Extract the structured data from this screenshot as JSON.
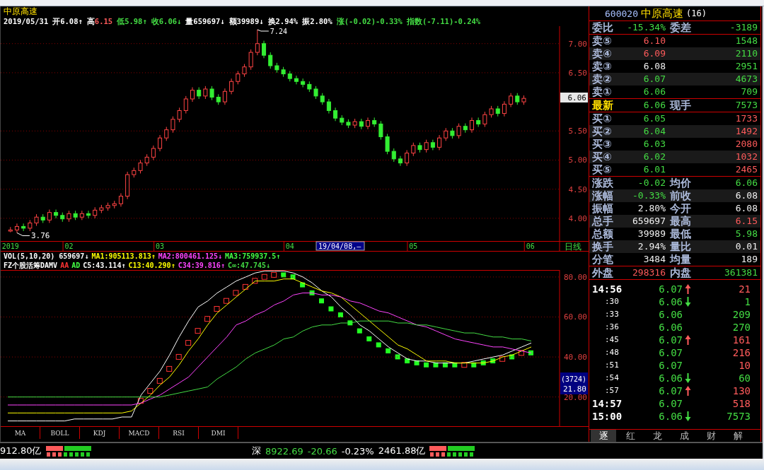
{
  "stock_title": "中原高速",
  "info_line": [
    {
      "text": "2019/05/31",
      "color": "#ffffff"
    },
    {
      "text": "开6.08↑",
      "color": "#ffffff"
    },
    {
      "text": "高",
      "color": "#ffffff"
    },
    {
      "text": "6.15",
      "color": "#ff5b5b"
    },
    {
      "text": "低5.98↑",
      "color": "#44dd44"
    },
    {
      "text": "收6.06↓",
      "color": "#44dd44"
    },
    {
      "text": "量659697↓",
      "color": "#ffffff"
    },
    {
      "text": "额39989↓",
      "color": "#ffffff"
    },
    {
      "text": "换2.94%",
      "color": "#ffffff"
    },
    {
      "text": "振2.80%",
      "color": "#ffffff"
    },
    {
      "text": "涨(-0.02)-0.33%",
      "color": "#44dd44"
    },
    {
      "text": "指数(-7.11)-0.24%",
      "color": "#44dd44"
    }
  ],
  "price_chart": {
    "chart_data": {
      "type": "candlestick",
      "grid": true,
      "categories": [
        null,
        "2019",
        null,
        null,
        null,
        null,
        null,
        null,
        null,
        null,
        "02",
        null,
        null,
        null,
        null,
        null,
        null,
        null,
        null,
        null,
        null,
        null,
        null,
        null,
        "03",
        null,
        null,
        null,
        null,
        null,
        null,
        null,
        null,
        null,
        null,
        null,
        null,
        null,
        null,
        null,
        null,
        null,
        null,
        null,
        "04",
        null,
        null,
        null,
        null,
        null,
        null,
        null,
        null,
        null,
        null,
        null,
        null,
        null,
        null,
        null,
        null,
        null,
        null,
        "05",
        null,
        null,
        null,
        null,
        null,
        null,
        null,
        null,
        null,
        null,
        null,
        null,
        null,
        null,
        null,
        null,
        null,
        "06",
        null,
        null,
        null,
        null
      ],
      "ohlc": [
        null,
        [
          3.78,
          3.85,
          3.76,
          3.8
        ],
        [
          3.8,
          3.91,
          3.75,
          3.86
        ],
        [
          3.86,
          3.91,
          3.78,
          3.83
        ],
        [
          3.83,
          3.97,
          3.78,
          3.92
        ],
        [
          3.92,
          4.07,
          3.87,
          4.02
        ],
        [
          4.02,
          4.07,
          3.92,
          3.97
        ],
        [
          3.97,
          4.15,
          3.92,
          4.1
        ],
        [
          4.1,
          4.15,
          4.0,
          4.05
        ],
        [
          4.05,
          4.1,
          3.94,
          3.99
        ],
        [
          3.99,
          4.13,
          3.94,
          4.08
        ],
        [
          4.08,
          4.13,
          3.97,
          4.02
        ],
        [
          4.02,
          4.13,
          3.97,
          4.08
        ],
        [
          4.08,
          4.13,
          4.0,
          4.05
        ],
        [
          4.05,
          4.19,
          4.0,
          4.14
        ],
        [
          4.14,
          4.23,
          4.09,
          4.18
        ],
        [
          4.18,
          4.27,
          4.13,
          4.22
        ],
        [
          4.22,
          4.3,
          4.17,
          4.25
        ],
        [
          4.25,
          4.43,
          4.2,
          4.38
        ],
        [
          4.38,
          4.8,
          4.33,
          4.75
        ],
        [
          4.75,
          4.87,
          4.7,
          4.82
        ],
        [
          4.82,
          5.0,
          4.77,
          4.95
        ],
        [
          4.95,
          5.1,
          4.9,
          5.05
        ],
        [
          5.05,
          5.25,
          5.0,
          5.2
        ],
        [
          5.2,
          5.43,
          5.15,
          5.38
        ],
        [
          5.38,
          5.57,
          5.33,
          5.52
        ],
        [
          5.52,
          5.75,
          5.47,
          5.7
        ],
        [
          5.7,
          5.9,
          5.65,
          5.85
        ],
        [
          5.85,
          6.1,
          5.8,
          6.05
        ],
        [
          6.05,
          6.25,
          6.0,
          6.2
        ],
        [
          6.2,
          6.25,
          6.05,
          6.1
        ],
        [
          6.1,
          6.27,
          6.05,
          6.22
        ],
        [
          6.22,
          6.27,
          6.03,
          6.08
        ],
        [
          6.08,
          6.13,
          5.95,
          6.0
        ],
        [
          6.0,
          6.23,
          5.95,
          6.18
        ],
        [
          6.18,
          6.4,
          6.13,
          6.35
        ],
        [
          6.35,
          6.53,
          6.3,
          6.48
        ],
        [
          6.48,
          6.65,
          6.43,
          6.6
        ],
        [
          6.6,
          6.9,
          6.55,
          6.85
        ],
        [
          6.85,
          7.24,
          6.8,
          7.0
        ],
        [
          7.0,
          7.05,
          6.75,
          6.8
        ],
        [
          6.8,
          6.85,
          6.57,
          6.62
        ],
        [
          6.62,
          6.67,
          6.5,
          6.55
        ],
        [
          6.55,
          6.6,
          6.43,
          6.48
        ],
        [
          6.48,
          6.53,
          6.35,
          6.4
        ],
        [
          6.4,
          6.45,
          6.3,
          6.35
        ],
        [
          6.35,
          6.4,
          6.25,
          6.3
        ],
        [
          6.3,
          6.35,
          6.17,
          6.22
        ],
        [
          6.22,
          6.27,
          6.05,
          6.1
        ],
        [
          6.1,
          6.15,
          5.95,
          6.0
        ],
        [
          6.0,
          6.05,
          5.8,
          5.85
        ],
        [
          5.85,
          5.9,
          5.67,
          5.72
        ],
        [
          5.72,
          5.77,
          5.6,
          5.65
        ],
        [
          5.65,
          5.7,
          5.55,
          5.6
        ],
        [
          5.6,
          5.71,
          5.55,
          5.66
        ],
        [
          5.66,
          5.71,
          5.53,
          5.58
        ],
        [
          5.58,
          5.73,
          5.53,
          5.68
        ],
        [
          5.68,
          5.73,
          5.57,
          5.62
        ],
        [
          5.62,
          5.67,
          5.35,
          5.4
        ],
        [
          5.4,
          5.45,
          5.1,
          5.15
        ],
        [
          5.15,
          5.2,
          4.97,
          5.02
        ],
        [
          5.02,
          5.07,
          4.9,
          4.95
        ],
        [
          4.95,
          5.17,
          4.9,
          5.12
        ],
        [
          5.12,
          5.3,
          5.07,
          5.25
        ],
        [
          5.25,
          5.3,
          5.13,
          5.18
        ],
        [
          5.18,
          5.35,
          5.13,
          5.3
        ],
        [
          5.3,
          5.35,
          5.17,
          5.22
        ],
        [
          5.22,
          5.43,
          5.17,
          5.38
        ],
        [
          5.38,
          5.55,
          5.33,
          5.5
        ],
        [
          5.5,
          5.55,
          5.37,
          5.42
        ],
        [
          5.42,
          5.63,
          5.37,
          5.58
        ],
        [
          5.58,
          5.63,
          5.47,
          5.52
        ],
        [
          5.52,
          5.73,
          5.47,
          5.68
        ],
        [
          5.68,
          5.73,
          5.57,
          5.62
        ],
        [
          5.62,
          5.83,
          5.57,
          5.78
        ],
        [
          5.78,
          5.93,
          5.73,
          5.88
        ],
        [
          5.88,
          5.93,
          5.75,
          5.8
        ],
        [
          5.8,
          6.01,
          5.75,
          5.96
        ],
        [
          5.96,
          6.15,
          5.91,
          6.1
        ],
        [
          6.1,
          6.15,
          5.95,
          6.0
        ],
        [
          6.0,
          6.11,
          5.95,
          6.06
        ],
        null,
        null,
        null,
        null,
        null
      ],
      "ylim": [
        3.61,
        7.3
      ],
      "yticks": [
        {
          "value": 7,
          "label": "7.00"
        },
        {
          "value": 6.5,
          "label": "6.50"
        },
        {
          "value": 5.5,
          "label": "5.50"
        },
        {
          "value": 5,
          "label": "5.00"
        },
        {
          "value": 4.5,
          "label": "4.50"
        },
        {
          "value": 4,
          "label": "4.00"
        }
      ],
      "annotations": [
        {
          "text": "7.24"
        },
        {
          "text": "3.76"
        }
      ]
    }
  },
  "last_price_marker": "6.06",
  "cursor_date": "19/04/08,—",
  "period": "日线",
  "volume_header": [
    {
      "text": "VOL(5,10,20) 659697↓",
      "color": "#ffffff"
    },
    {
      "text": "MA1:905113.813↑",
      "color": "#ffff00"
    },
    {
      "text": "MA2:800461.125↓",
      "color": "#ff44ff"
    },
    {
      "text": "MA3:759937.5↑",
      "color": "#44ff44"
    }
  ],
  "indicator_header": [
    {
      "text": "FZ个股活筹DAMV",
      "color": "#ffffff"
    },
    {
      "text": "AA",
      "color": "#ff3333"
    },
    {
      "text": "AD",
      "color": "#44ff44"
    }
  ],
  "indicator_chart": {
    "chart_data": {
      "type": "line",
      "grid": true,
      "ylim": [
        5.4,
        83.5
      ],
      "yticks": [
        {
          "value": 80,
          "label": "80.00"
        },
        {
          "value": 60,
          "label": "60.00"
        },
        {
          "value": 40,
          "label": "40.00"
        },
        {
          "value": 20,
          "label": "20.00"
        }
      ],
      "series": [
        {
          "name": "C5",
          "color": "#ffffff",
          "values": [
            8,
            8,
            8,
            8,
            8,
            8,
            8,
            9,
            9,
            9,
            9,
            9,
            10,
            10,
            21,
            27,
            33,
            41,
            50,
            58,
            65,
            68,
            72,
            75,
            78,
            80,
            82,
            83,
            83,
            83,
            82,
            80,
            77,
            73,
            70,
            65,
            61,
            56,
            53,
            49,
            45,
            42,
            39,
            38,
            38,
            37,
            37,
            37,
            37,
            38,
            39,
            40,
            41,
            43,
            45,
            47
          ]
        },
        {
          "name": "C13",
          "color": "#ffff00",
          "values": [
            12,
            12,
            12,
            12,
            12,
            12,
            12,
            12,
            12,
            12,
            12,
            12,
            12,
            13,
            17,
            21,
            26,
            30,
            36,
            43,
            49,
            56,
            62,
            66,
            70,
            74,
            78,
            78,
            78,
            79,
            79,
            77,
            75,
            73,
            72,
            70,
            66,
            62,
            58,
            54,
            50,
            46,
            44,
            41,
            38,
            38,
            38,
            37,
            37,
            37,
            37,
            38,
            40,
            41,
            43,
            45
          ]
        },
        {
          "name": "C34",
          "color": "#ff44ff",
          "values": [
            16,
            16,
            16,
            16,
            16,
            16,
            16,
            16,
            16,
            16,
            16,
            16,
            16,
            16,
            17,
            19,
            21,
            24,
            27,
            30,
            35,
            40,
            45,
            50,
            56,
            58,
            61,
            63,
            66,
            68,
            71,
            72,
            72,
            71,
            71,
            70,
            68,
            67,
            65,
            63,
            62,
            60,
            58,
            56,
            55,
            53,
            51,
            49,
            48,
            47,
            46,
            45,
            45,
            44,
            43,
            42
          ]
        },
        {
          "name": "C∞",
          "color": "#44dd44",
          "values": [
            20,
            20,
            20,
            20,
            20,
            20,
            20,
            20,
            20,
            20,
            20,
            20,
            20,
            20,
            20,
            20,
            20,
            21,
            22,
            23,
            24,
            25,
            29,
            32,
            35,
            39,
            42,
            44,
            46,
            49,
            50,
            53,
            55,
            56,
            56,
            57,
            57,
            58,
            58,
            58,
            58,
            57,
            57,
            56,
            56,
            55,
            54,
            53,
            52,
            52,
            51,
            50,
            50,
            49,
            49,
            48
          ]
        }
      ]
    }
  },
  "indicator_readings": [
    ":43.114↑",
    ":40.290↑",
    ":39.816↑",
    ":47.745↓"
  ],
  "indicator_marker_top": "(3724)",
  "indicator_marker_value": "21.80",
  "indicator_tabs": [
    {
      "label": "MA",
      "selected": false
    },
    {
      "label": "BOLL",
      "selected": false
    },
    {
      "label": "KDJ",
      "selected": false
    },
    {
      "label": "MACD",
      "selected": false
    },
    {
      "label": "RSI",
      "selected": false
    },
    {
      "label": "DMI",
      "selected": false
    }
  ],
  "quote": {
    "code": "600020",
    "name": "中原高速",
    "count": "(16)",
    "groups": [
      {
        "rows": [
          {
            "kind": "pair",
            "cells": [
              {
                "text": "委比",
                "color": "#aab8d8"
              },
              {
                "text": "-15.34%",
                "color": "#44dd44"
              },
              {
                "text": "委差",
                "color": "#aab8d8"
              },
              {
                "text": "-3189",
                "color": "#44dd44"
              }
            ]
          }
        ]
      },
      {
        "rows": [
          {
            "kind": "book",
            "cells": [
              {
                "text": "卖⑤",
                "color": "#aab8d8"
              },
              {
                "text": "6.10",
                "color": "#ff5b5b"
              },
              {
                "text": "1548",
                "color": "#44dd44"
              }
            ]
          },
          {
            "kind": "book",
            "cells": [
              {
                "text": "卖④",
                "color": "#aab8d8"
              },
              {
                "text": "6.09",
                "color": "#ff5b5b"
              },
              {
                "text": "2110",
                "color": "#44dd44"
              }
            ]
          },
          {
            "kind": "book",
            "cells": [
              {
                "text": "卖③",
                "color": "#aab8d8"
              },
              {
                "text": "6.08",
                "color": "#f0f0f0"
              },
              {
                "text": "2951",
                "color": "#44dd44"
              }
            ]
          },
          {
            "kind": "book",
            "cells": [
              {
                "text": "卖②",
                "color": "#aab8d8"
              },
              {
                "text": "6.07",
                "color": "#44dd44"
              },
              {
                "text": "4673",
                "color": "#44dd44"
              }
            ]
          },
          {
            "kind": "book",
            "cells": [
              {
                "text": "卖①",
                "color": "#aab8d8"
              },
              {
                "text": "6.06",
                "color": "#44dd44"
              },
              {
                "text": "709",
                "color": "#44dd44"
              }
            ]
          }
        ]
      },
      {
        "rows": [
          {
            "kind": "pair",
            "cells": [
              {
                "text": "最新",
                "color": "#ffe000"
              },
              {
                "text": "6.06",
                "color": "#44dd44"
              },
              {
                "text": "现手",
                "color": "#aab8d8"
              },
              {
                "text": "7573",
                "color": "#44dd44"
              }
            ]
          }
        ]
      },
      {
        "rows": [
          {
            "kind": "book",
            "cells": [
              {
                "text": "买①",
                "color": "#aab8d8"
              },
              {
                "text": "6.05",
                "color": "#44dd44"
              },
              {
                "text": "1733",
                "color": "#ff5b5b"
              }
            ]
          },
          {
            "kind": "book",
            "cells": [
              {
                "text": "买②",
                "color": "#aab8d8"
              },
              {
                "text": "6.04",
                "color": "#44dd44"
              },
              {
                "text": "1492",
                "color": "#ff5b5b"
              }
            ]
          },
          {
            "kind": "book",
            "cells": [
              {
                "text": "买③",
                "color": "#aab8d8"
              },
              {
                "text": "6.03",
                "color": "#44dd44"
              },
              {
                "text": "2080",
                "color": "#ff5b5b"
              }
            ]
          },
          {
            "kind": "book",
            "cells": [
              {
                "text": "买④",
                "color": "#aab8d8"
              },
              {
                "text": "6.02",
                "color": "#44dd44"
              },
              {
                "text": "1032",
                "color": "#ff5b5b"
              }
            ]
          },
          {
            "kind": "book",
            "cells": [
              {
                "text": "买⑤",
                "color": "#aab8d8"
              },
              {
                "text": "6.01",
                "color": "#44dd44"
              },
              {
                "text": "2465",
                "color": "#ff5b5b"
              }
            ]
          }
        ]
      },
      {
        "rows": [
          {
            "kind": "pair",
            "cells": [
              {
                "text": "涨跌",
                "color": "#aab8d8"
              },
              {
                "text": "-0.02",
                "color": "#44dd44"
              },
              {
                "text": "均价",
                "color": "#aab8d8"
              },
              {
                "text": "6.06",
                "color": "#44dd44"
              }
            ]
          },
          {
            "kind": "pair",
            "cells": [
              {
                "text": "涨幅",
                "color": "#aab8d8"
              },
              {
                "text": "-0.33%",
                "color": "#44dd44"
              },
              {
                "text": "前收",
                "color": "#aab8d8"
              },
              {
                "text": "6.08",
                "color": "#f0f0f0"
              }
            ]
          },
          {
            "kind": "pair",
            "cells": [
              {
                "text": "振幅",
                "color": "#aab8d8"
              },
              {
                "text": "2.80%",
                "color": "#f0f0f0"
              },
              {
                "text": "今开",
                "color": "#aab8d8"
              },
              {
                "text": "6.08",
                "color": "#f0f0f0"
              }
            ]
          },
          {
            "kind": "pair",
            "cells": [
              {
                "text": "总手",
                "color": "#aab8d8"
              },
              {
                "text": "659697",
                "color": "#f0f0f0"
              },
              {
                "text": "最高",
                "color": "#aab8d8"
              },
              {
                "text": "6.15",
                "color": "#ff5b5b"
              }
            ]
          },
          {
            "kind": "pair",
            "cells": [
              {
                "text": "总额",
                "color": "#aab8d8"
              },
              {
                "text": "39989",
                "color": "#f0f0f0"
              },
              {
                "text": "最低",
                "color": "#aab8d8"
              },
              {
                "text": "5.98",
                "color": "#44dd44"
              }
            ]
          },
          {
            "kind": "pair",
            "cells": [
              {
                "text": "换手",
                "color": "#aab8d8"
              },
              {
                "text": "2.94%",
                "color": "#f0f0f0"
              },
              {
                "text": "量比",
                "color": "#aab8d8"
              },
              {
                "text": "0.01",
                "color": "#f0f0f0"
              }
            ]
          },
          {
            "kind": "pair",
            "cells": [
              {
                "text": "分笔",
                "color": "#aab8d8"
              },
              {
                "text": "3484",
                "color": "#f0f0f0"
              },
              {
                "text": "均量",
                "color": "#aab8d8"
              },
              {
                "text": "189",
                "color": "#f0f0f0"
              }
            ]
          }
        ]
      },
      {
        "rows": [
          {
            "kind": "pair",
            "cells": [
              {
                "text": "外盘",
                "color": "#aab8d8"
              },
              {
                "text": "298316",
                "color": "#ff5b5b"
              },
              {
                "text": "内盘",
                "color": "#aab8d8"
              },
              {
                "text": "361381",
                "color": "#44dd44"
              }
            ]
          }
        ]
      }
    ],
    "trades": [
      {
        "time": "14:56",
        "kind": "full",
        "price": "6.07",
        "arrow_up": true,
        "arrow_down": false,
        "volume": "21",
        "color": "#ff5b5b"
      },
      {
        "time": ":30",
        "kind": "tick",
        "price": "6.06",
        "arrow_up": false,
        "arrow_down": true,
        "volume": "1",
        "color": "#44dd44"
      },
      {
        "time": ":33",
        "kind": "tick",
        "price": "6.06",
        "arrow_up": false,
        "arrow_down": false,
        "volume": "209",
        "color": "#44dd44"
      },
      {
        "time": ":36",
        "kind": "tick",
        "price": "6.06",
        "arrow_up": false,
        "arrow_down": false,
        "volume": "270",
        "color": "#44dd44"
      },
      {
        "time": ":45",
        "kind": "tick",
        "price": "6.07",
        "arrow_up": true,
        "arrow_down": false,
        "volume": "161",
        "color": "#ff5b5b"
      },
      {
        "time": ":48",
        "kind": "tick",
        "price": "6.07",
        "arrow_up": false,
        "arrow_down": false,
        "volume": "216",
        "color": "#ff5b5b"
      },
      {
        "time": ":51",
        "kind": "tick",
        "price": "6.07",
        "arrow_up": false,
        "arrow_down": false,
        "volume": "10",
        "color": "#ff5b5b"
      },
      {
        "time": ":54",
        "kind": "tick",
        "price": "6.06",
        "arrow_up": false,
        "arrow_down": true,
        "volume": "60",
        "color": "#44dd44"
      },
      {
        "time": ":57",
        "kind": "tick",
        "price": "6.07",
        "arrow_up": true,
        "arrow_down": false,
        "volume": "130",
        "color": "#ff5b5b"
      },
      {
        "time": "14:57",
        "kind": "full",
        "price": "6.07",
        "arrow_up": false,
        "arrow_down": false,
        "volume": "518",
        "color": "#ff5b5b"
      },
      {
        "time": "15:00",
        "kind": "full",
        "price": "6.06",
        "arrow_up": false,
        "arrow_down": true,
        "volume": "7573",
        "color": "#44dd44"
      }
    ],
    "tabs": [
      {
        "label": "逐",
        "selected": true
      },
      {
        "label": "红",
        "selected": false
      },
      {
        "label": "龙",
        "selected": false
      },
      {
        "label": "成",
        "selected": false
      },
      {
        "label": "财",
        "selected": false
      },
      {
        "label": "解",
        "selected": false
      }
    ]
  },
  "status_bar": {
    "left_amount": "912.80亿",
    "market": "深",
    "index": "8922.69",
    "change": "-20.66",
    "percent": "-0.23%",
    "amount": "2461.88亿"
  }
}
